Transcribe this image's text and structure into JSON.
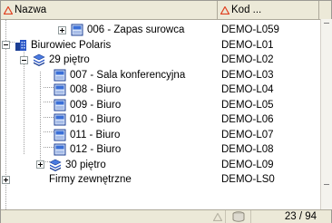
{
  "columns": {
    "name_label": "Nazwa",
    "code_label": "Kod ..."
  },
  "rows": [
    {
      "name": "006 - Zapas surowca",
      "code": "DEMO-L059",
      "icon": "box-icon"
    },
    {
      "name": "Biurowiec Polaris",
      "code": "DEMO-L01",
      "icon": "building-icon"
    },
    {
      "name": "29 piętro",
      "code": "DEMO-L02",
      "icon": "floor-stack-icon"
    },
    {
      "name": "007 - Sala konferencyjna",
      "code": "DEMO-L03",
      "icon": "room-icon"
    },
    {
      "name": "008 - Biuro",
      "code": "DEMO-L04",
      "icon": "room-icon"
    },
    {
      "name": "009 - Biuro",
      "code": "DEMO-L05",
      "icon": "room-icon"
    },
    {
      "name": "010 - Biuro",
      "code": "DEMO-L06",
      "icon": "room-icon"
    },
    {
      "name": "011 - Biuro",
      "code": "DEMO-L07",
      "icon": "room-icon"
    },
    {
      "name": "012 - Biuro",
      "code": "DEMO-L08",
      "icon": "room-icon"
    },
    {
      "name": "30 piętro",
      "code": "DEMO-L09",
      "icon": "floor-stack-icon"
    },
    {
      "name": "Firmy zewnętrzne",
      "code": "DEMO-LS0",
      "icon": ""
    }
  ],
  "status": {
    "count": "23 / 94"
  },
  "colors": {
    "sort_indicator": "#e04020",
    "header_bg": "#ece9d8",
    "floor_icon": "#2a56c6",
    "room_icon": "#3a6fd8"
  }
}
